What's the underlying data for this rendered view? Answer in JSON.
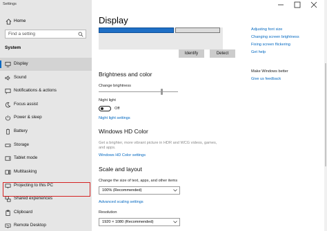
{
  "window": {
    "title": "Settings"
  },
  "sidebar": {
    "home_label": "Home",
    "search_placeholder": "Find a setting",
    "section_label": "System",
    "items": [
      {
        "label": "Display",
        "icon": "monitor-icon",
        "active": true
      },
      {
        "label": "Sound",
        "icon": "speaker-icon"
      },
      {
        "label": "Notifications & actions",
        "icon": "notification-icon"
      },
      {
        "label": "Focus assist",
        "icon": "moon-icon"
      },
      {
        "label": "Power & sleep",
        "icon": "power-icon"
      },
      {
        "label": "Battery",
        "icon": "battery-icon"
      },
      {
        "label": "Storage",
        "icon": "storage-icon"
      },
      {
        "label": "Tablet mode",
        "icon": "tablet-icon"
      },
      {
        "label": "Multitasking",
        "icon": "multitasking-icon"
      },
      {
        "label": "Projecting to this PC",
        "icon": "projector-icon"
      },
      {
        "label": "Shared experiences",
        "icon": "shared-icon"
      },
      {
        "label": "Clipboard",
        "icon": "clipboard-icon"
      },
      {
        "label": "Remote Desktop",
        "icon": "remote-desktop-icon"
      }
    ]
  },
  "main": {
    "title": "Display",
    "identify_label": "Identify",
    "detect_label": "Detect",
    "brightness_heading": "Brightness and color",
    "change_brightness_label": "Change brightness",
    "night_light_label": "Night light",
    "night_light_state": "Off",
    "night_light_settings_link": "Night light settings",
    "hd_color_heading": "Windows HD Color",
    "hd_color_desc_line1": "Get a brighter, more vibrant picture in HDR and WCG videos, games,",
    "hd_color_desc_line2": "and apps.",
    "hd_color_settings_link": "Windows HD Color settings",
    "scale_heading": "Scale and layout",
    "scale_label": "Change the size of text, apps, and other items",
    "scale_value": "100% (Recommended)",
    "advanced_scaling_link": "Advanced scaling settings",
    "resolution_label": "Resolution",
    "resolution_value": "1920 × 1080 (Recommended)"
  },
  "right_panel": {
    "links": [
      "Adjusting font size",
      "Changing screen brightness",
      "Fixing screen flickering",
      "Get help"
    ],
    "better_label": "Make Windows better",
    "feedback_link": "Give us feedback"
  },
  "colors": {
    "accent": "#0067c0",
    "highlight_box": "#d42020",
    "sidebar_bg": "#e6e6e6"
  }
}
